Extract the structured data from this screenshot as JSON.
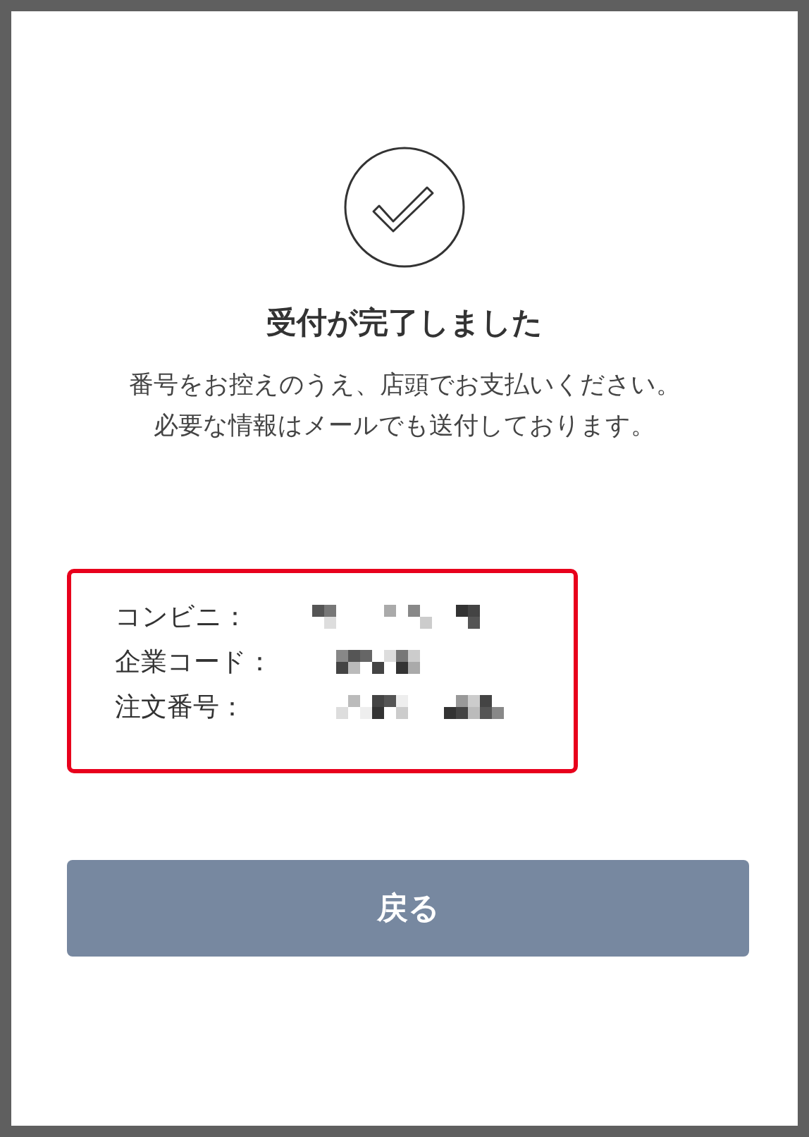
{
  "title": "受付が完了しました",
  "message": [
    "番号をお控えのうえ、店頭でお支払いください。",
    "必要な情報はメールでも送付しております。"
  ],
  "details": [
    {
      "label": "コンビニ："
    },
    {
      "label": "企業コード："
    },
    {
      "label": "注文番号："
    }
  ],
  "button": "戻る"
}
